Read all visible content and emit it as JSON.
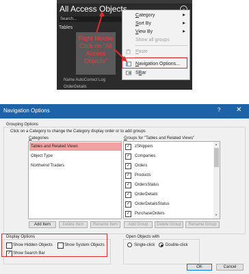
{
  "top": {
    "pane_title": "All Access Objects",
    "search_placeholder": "Search...",
    "section": "Tables",
    "rows": [
      "Name AutoCorrect Log",
      "OrderDetails"
    ],
    "annotation": "Right Mouse Click on \"All Access Objects\"",
    "menu": [
      {
        "label": "Category",
        "u": "C",
        "submenu": true,
        "enabled": true
      },
      {
        "label": "Sort By",
        "u": "S",
        "submenu": true,
        "enabled": true
      },
      {
        "label": "View By",
        "u": "V",
        "submenu": true,
        "enabled": true
      },
      {
        "label": "Show all groups",
        "submenu": false,
        "enabled": false
      },
      {
        "label": "Paste",
        "u": "P",
        "submenu": false,
        "enabled": false,
        "icon": "paste-icon"
      },
      {
        "label": "Navigation Options...",
        "u": "N",
        "submenu": false,
        "enabled": true,
        "icon": "navigation-options-icon",
        "highlighted": true
      },
      {
        "label": "Search Bar",
        "u": "B",
        "submenu": false,
        "enabled": true,
        "icon": "search-bar-icon"
      }
    ]
  },
  "dialog": {
    "title": "Navigation Options",
    "help": "?",
    "close": "✕",
    "grouping_options": "Grouping Options",
    "instructions": "Click on a Category to change the Category display order or to add groups",
    "categories_label": "Categories",
    "groups_label": "Groups for \"Tables and Related Views\"",
    "categories": [
      "Tables and Related Views",
      "Object Type",
      "Northwind Traders"
    ],
    "selected_category": 0,
    "groups": [
      "zShippers",
      "Companies",
      "Orders",
      "Products",
      "OrdersStatus",
      "OrderDetails",
      "OrderDetailsStatus",
      "PurchaseOrders"
    ],
    "buttons": {
      "add_item": "Add Item",
      "delete_item": "Delete Item",
      "rename_item": "Rename Item",
      "add_group": "Add Group",
      "delete_group": "Delete Group",
      "rename_group": "Rename Group",
      "ok": "OK",
      "cancel": "Cancel"
    },
    "display_options": "Display Options",
    "show_hidden": "Show Hidden Objects",
    "show_system": "Show System Objects",
    "show_search_bar": "Show Search Bar",
    "show_hidden_checked": false,
    "show_system_checked": false,
    "show_search_bar_checked": true,
    "open_objects_with": "Open Objects with",
    "single_click": "Single-click",
    "double_click": "Double-click",
    "open_mode": "double"
  },
  "colors": {
    "highlight": "#e02b2b",
    "selection": "#f3a2a2",
    "titlebar": "#1e63a8"
  }
}
